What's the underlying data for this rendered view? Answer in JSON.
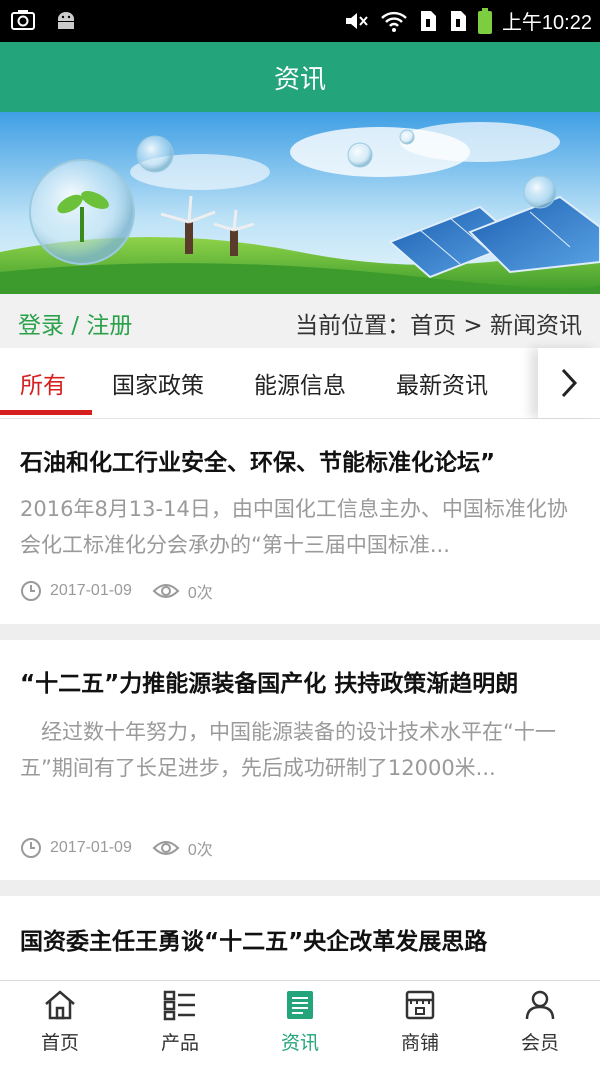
{
  "status_bar": {
    "time": "上午10:22"
  },
  "app_bar": {
    "title": "资讯"
  },
  "location_bar": {
    "login": "登录 / 注册",
    "location": "当前位置：首页 > 新闻资讯"
  },
  "tabs": [
    {
      "label": "所有",
      "active": true
    },
    {
      "label": "国家政策",
      "active": false
    },
    {
      "label": "能源信息",
      "active": false
    },
    {
      "label": "最新资讯",
      "active": false
    }
  ],
  "articles": [
    {
      "title": "石油和化工行业安全、环保、节能标准化论坛”",
      "summary": "2016年8月13-14日，由中国化工信息主办、中国标准化协会化工标准化分会承办的“第十三届中国标准...",
      "date": "2017-01-09",
      "views": "0次"
    },
    {
      "title": "“十二五”力推能源装备国产化 扶持政策渐趋明朗",
      "summary": "　经过数十年努力，中国能源装备的设计技术水平在“十一五”期间有了长足进步，先后成功研制了12000米...",
      "date": "2017-01-09",
      "views": "0次"
    },
    {
      "title": "国资委主任王勇谈“十二五”央企改革发展思路"
    }
  ],
  "bottom_nav": [
    {
      "label": "首页",
      "icon": "home-icon"
    },
    {
      "label": "产品",
      "icon": "product-list-icon"
    },
    {
      "label": "资讯",
      "icon": "news-icon",
      "active": true
    },
    {
      "label": "商铺",
      "icon": "shop-icon"
    },
    {
      "label": "会员",
      "icon": "member-icon"
    }
  ],
  "colors": {
    "primary": "#23a47b",
    "active_tab": "#d6201f",
    "login": "#2aa14a"
  }
}
